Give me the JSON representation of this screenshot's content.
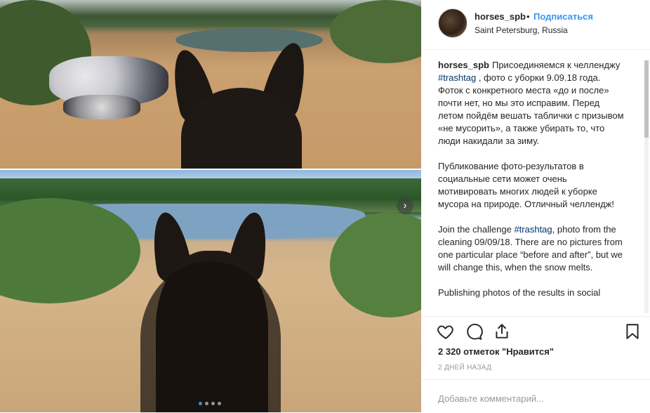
{
  "post": {
    "username": "horses_spb",
    "separator": "•",
    "follow_label": "Подписаться",
    "location": "Saint Petersburg, Russia"
  },
  "caption": {
    "username": "horses_spb",
    "p1_before": "Присоединяемся к челленджу",
    "hashtag1": "#trashtag",
    "p1_after": ", фото с уборки 9.09.18 года. Фоток с конкретного места «до и после» почти нет, но мы это исправим. Перед летом пойдём вешать таблички с призывом «не мусорить», а также убирать то, что люди накидали за зиму.",
    "p2": "Публикование фото-результатов в социальные сети может очень мотивировать многих людей к уборке мусора на природе. Отличный челлендж!",
    "p3_before": "Join the challenge",
    "hashtag2": "#trashtag",
    "p3_after": ", photo from the cleaning 09/09/18. There are no pictures from one particular place “before and after”, but we will change this, when the snow melts.",
    "p4": "Publishing photos of the results in social"
  },
  "stats": {
    "likes": "2 320 отметок \"Нравится\"",
    "time_ago": "2 ДНЕЙ НАЗАД"
  },
  "comment": {
    "placeholder": "Добавьте комментарий..."
  },
  "carousel": {
    "next_icon": "›",
    "total_dots": 4,
    "active_index": 0
  },
  "colors": {
    "link": "#3897f0",
    "hashtag": "#003569",
    "muted": "#999999"
  },
  "icons": [
    "heart-icon",
    "comment-icon",
    "share-icon",
    "bookmark-icon",
    "chevron-right-icon"
  ]
}
